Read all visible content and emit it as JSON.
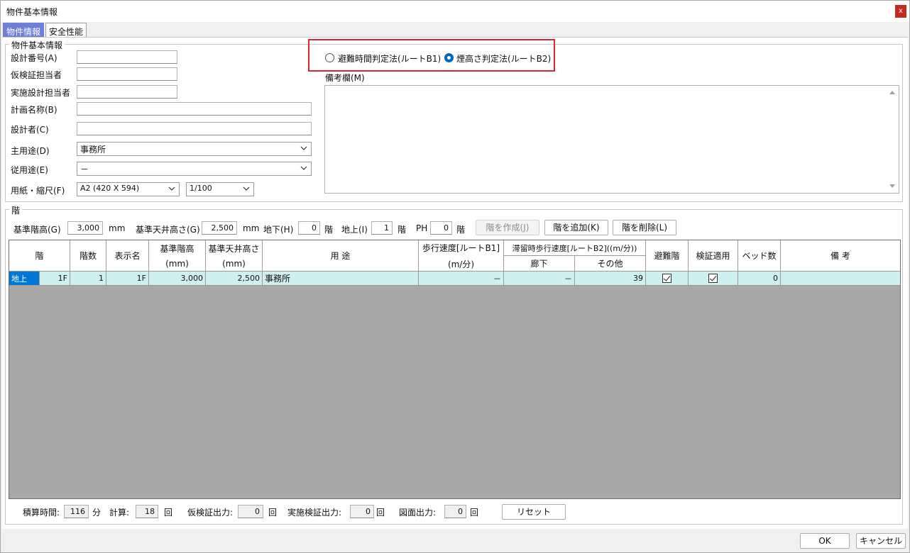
{
  "window": {
    "title": "物件基本情報",
    "close": "x"
  },
  "tabs": [
    {
      "label": "物件情報"
    },
    {
      "label": "安全性能"
    }
  ],
  "basic_info": {
    "group_title": "物件基本情報",
    "design_no_label": "設計番号(A)",
    "design_no_value": "",
    "temp_check_label": "仮検証担当者",
    "temp_check_value": "",
    "exec_design_label": "実施設計担当者",
    "exec_design_value": "",
    "plan_name_label": "計画名称(B)",
    "plan_name_value": "",
    "designer_label": "設計者(C)",
    "designer_value": "",
    "main_use_label": "主用途(D)",
    "main_use_value": "事務所",
    "sub_use_label": "従用途(E)",
    "sub_use_value": "－",
    "paper_label": "用紙・縮尺(F)",
    "paper_value": "A2 (420 X 594)",
    "scale_value": "1/100"
  },
  "route": {
    "b1_label": "避難時間判定法(ルートB1)",
    "b2_label": "煙高さ判定法(ルートB2)",
    "selected": "b2"
  },
  "remarks": {
    "label": "備考欄(M)",
    "value": ""
  },
  "floors": {
    "group_title": "階",
    "std_height_label": "基準階高(G)",
    "std_height_value": "3,000",
    "std_height_unit": "mm",
    "std_ceiling_label": "基準天井高さ(G)",
    "std_ceiling_value": "2,500",
    "std_ceiling_unit": "mm",
    "basement_label": "地下(H)",
    "basement_value": "0",
    "basement_unit": "階",
    "above_label": "地上(I)",
    "above_value": "1",
    "above_unit": "階",
    "ph_label": "PH",
    "ph_value": "0",
    "ph_unit": "階",
    "create_button": "階を作成(J)",
    "add_button": "階を追加(K)",
    "delete_button": "階を削除(L)"
  },
  "table": {
    "headers": {
      "floor": "階",
      "count": "階数",
      "display": "表示名",
      "std_height": "基準階高",
      "std_height_unit": "(mm)",
      "ceiling": "基準天井高さ",
      "ceiling_unit": "(mm)",
      "use": "用 途",
      "walk_speed": "歩行速度[ルートB1]",
      "walk_speed_unit": "(m/分)",
      "stay_speed": "滞留時歩行速度[ルートB2]((m/分))",
      "corridor": "廊下",
      "other": "その他",
      "refuge": "避難階",
      "apply": "検証適用",
      "beds": "ベッド数",
      "note": "備 考"
    },
    "rows": [
      {
        "floor_type": "地上",
        "floor": "1F",
        "count": "1",
        "display": "1F",
        "std_height": "3,000",
        "ceiling": "2,500",
        "use": "事務所",
        "walk_speed": "－",
        "corridor": "－",
        "other": "39",
        "refuge": true,
        "apply": true,
        "beds": "0",
        "note": ""
      }
    ]
  },
  "footer": {
    "calc_time_label": "積算時間:",
    "calc_time_value": "116",
    "calc_time_unit": "分",
    "calc_label": "計算:",
    "calc_value": "18",
    "calc_unit": "回",
    "temp_out_label": "仮検証出力:",
    "temp_out_value": "0",
    "temp_out_unit": "回",
    "exec_out_label": "実施検証出力:",
    "exec_out_value": "0",
    "exec_out_unit": "回",
    "drawing_out_label": "図面出力:",
    "drawing_out_value": "0",
    "drawing_out_unit": "回",
    "reset_button": "リセット"
  },
  "dialog_buttons": {
    "ok": "OK",
    "cancel": "キャンセル"
  },
  "colors": {
    "accent": "#0067c0",
    "tab_active": "#6e7fd8",
    "row_bg": "#cff0f1",
    "highlight": "#d9262f"
  }
}
